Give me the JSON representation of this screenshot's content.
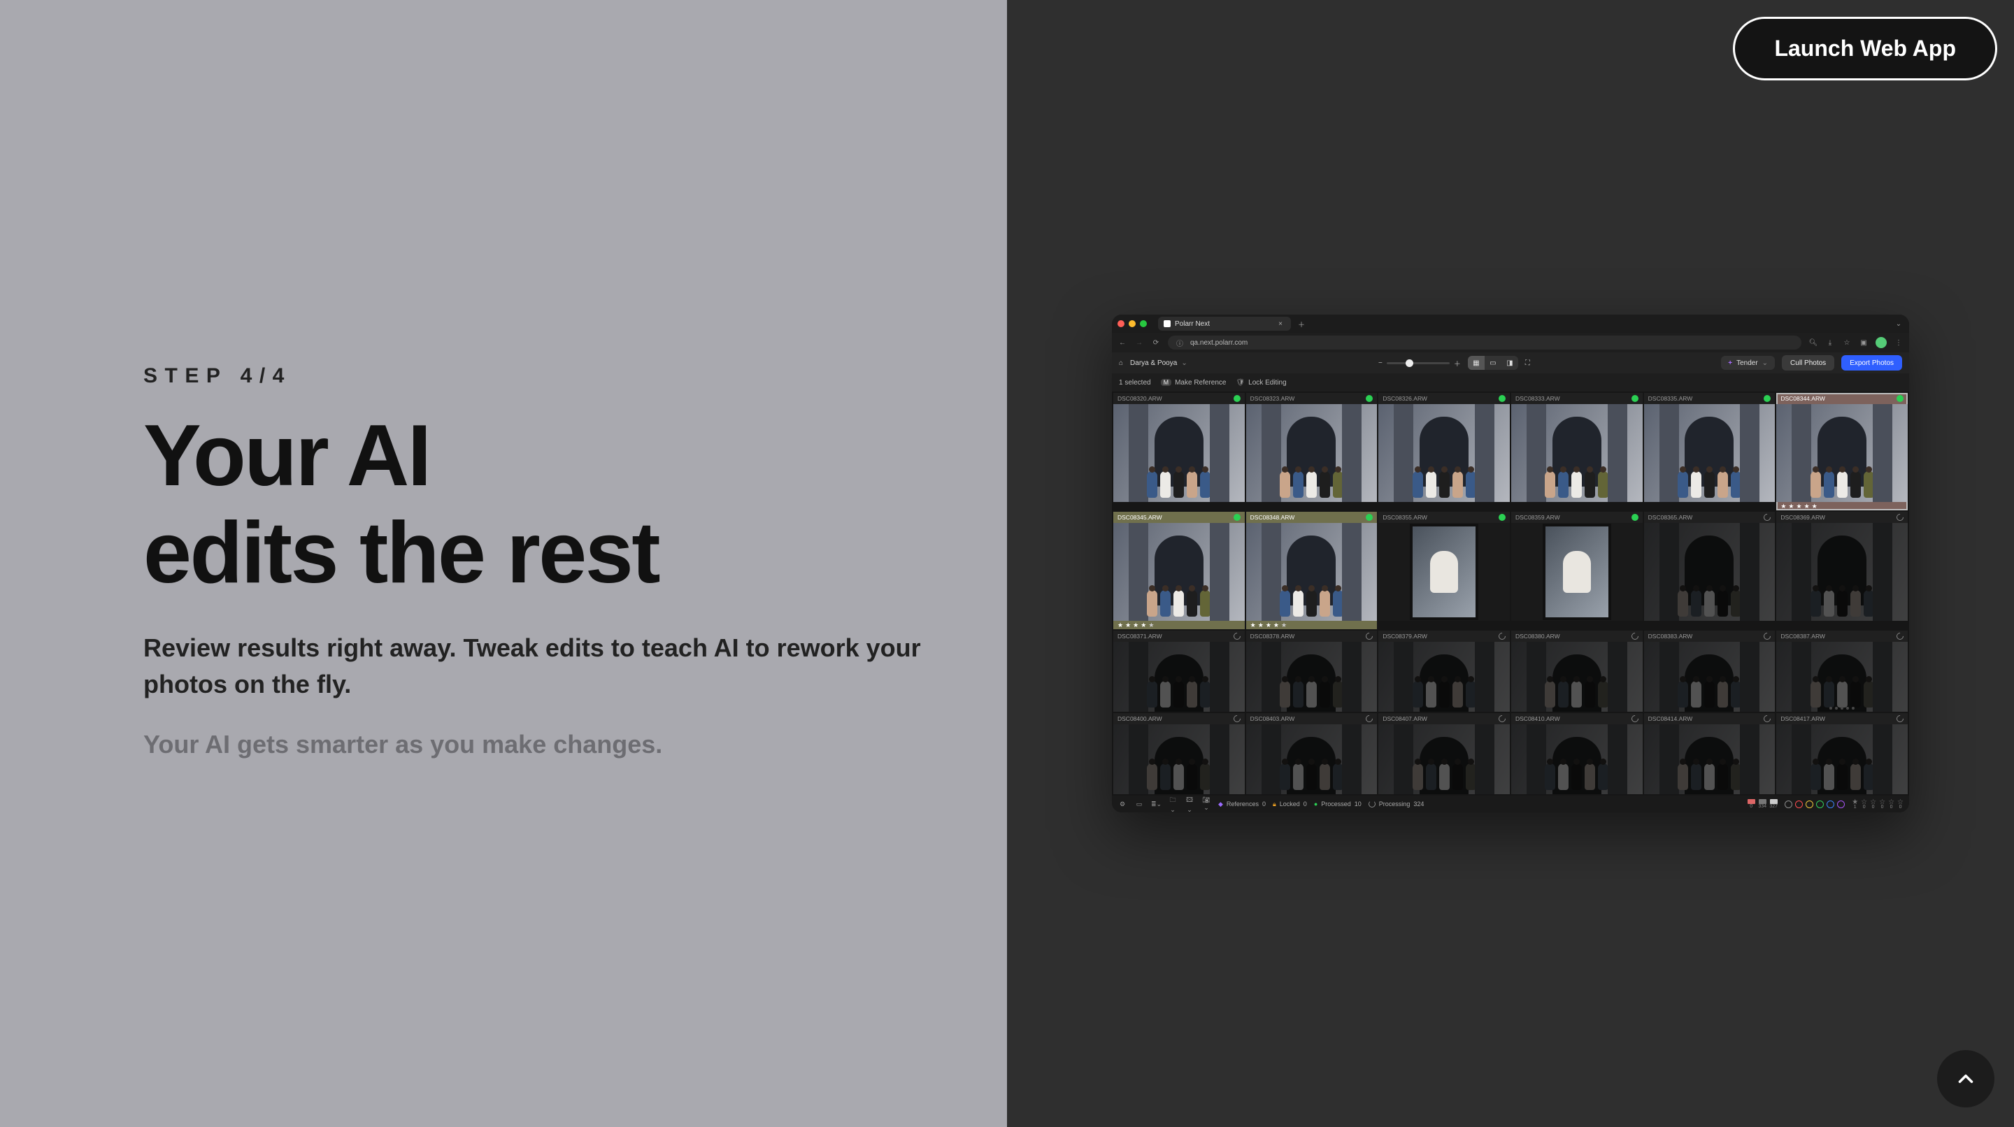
{
  "left": {
    "step": "STEP 4/4",
    "headline_l1": "Your AI",
    "headline_l2": "edits the rest",
    "body1": "Review results right away. Tweak edits to teach AI to rework your photos on the fly.",
    "body2": "Your AI gets smarter as you make changes."
  },
  "cta": {
    "launch": "Launch Web App"
  },
  "app": {
    "tab_title": "Polarr Next",
    "url": "qa.next.polarr.com",
    "breadcrumb": "Darya & Pooya",
    "tag_chip": "Tender",
    "cull_btn": "Cull Photos",
    "export_btn": "Export Photos",
    "selected": "1 selected",
    "make_ref_key": "M",
    "make_ref": "Make Reference",
    "lock_editing": "Lock Editing",
    "status": {
      "references": "References",
      "references_n": "0",
      "locked": "Locked",
      "locked_n": "0",
      "processed": "Processed",
      "processed_n": "10",
      "processing": "Processing",
      "processing_n": "324",
      "flags": [
        "0",
        "334",
        "327"
      ],
      "stars": [
        "1",
        "0",
        "0",
        "0",
        "0",
        "0"
      ]
    },
    "rows": [
      [
        {
          "name": "DSC08320.ARW",
          "state": "done"
        },
        {
          "name": "DSC08323.ARW",
          "state": "done"
        },
        {
          "name": "DSC08326.ARW",
          "state": "done"
        },
        {
          "name": "DSC08333.ARW",
          "state": "done"
        },
        {
          "name": "DSC08335.ARW",
          "state": "done"
        },
        {
          "name": "DSC08344.ARW",
          "state": "done",
          "selected": true,
          "rating": 5
        }
      ],
      [
        {
          "name": "DSC08345.ARW",
          "state": "done",
          "olive": true,
          "rating": 4
        },
        {
          "name": "DSC08348.ARW",
          "state": "done",
          "olive": true,
          "rating": 4
        },
        {
          "name": "DSC08355.ARW",
          "state": "done",
          "portrait": true
        },
        {
          "name": "DSC08359.ARW",
          "state": "done",
          "portrait": true
        },
        {
          "name": "DSC08365.ARW",
          "state": "proc",
          "dim": true
        },
        {
          "name": "DSC08369.ARW",
          "state": "proc",
          "dim": true
        }
      ],
      [
        {
          "name": "DSC08371.ARW",
          "state": "proc",
          "dim": true
        },
        {
          "name": "DSC08378.ARW",
          "state": "proc",
          "dim": true
        },
        {
          "name": "DSC08379.ARW",
          "state": "proc",
          "dim": true
        },
        {
          "name": "DSC08380.ARW",
          "state": "proc",
          "dim": true
        },
        {
          "name": "DSC08383.ARW",
          "state": "proc",
          "dim": true
        },
        {
          "name": "DSC08387.ARW",
          "state": "proc",
          "dim": true,
          "dots": true
        }
      ],
      [
        {
          "name": "DSC08400.ARW",
          "state": "proc",
          "dim": true
        },
        {
          "name": "DSC08403.ARW",
          "state": "proc",
          "dim": true
        },
        {
          "name": "DSC08407.ARW",
          "state": "proc",
          "dim": true
        },
        {
          "name": "DSC08410.ARW",
          "state": "proc",
          "dim": true
        },
        {
          "name": "DSC08414.ARW",
          "state": "proc",
          "dim": true
        },
        {
          "name": "DSC08417.ARW",
          "state": "proc",
          "dim": true
        }
      ]
    ]
  }
}
